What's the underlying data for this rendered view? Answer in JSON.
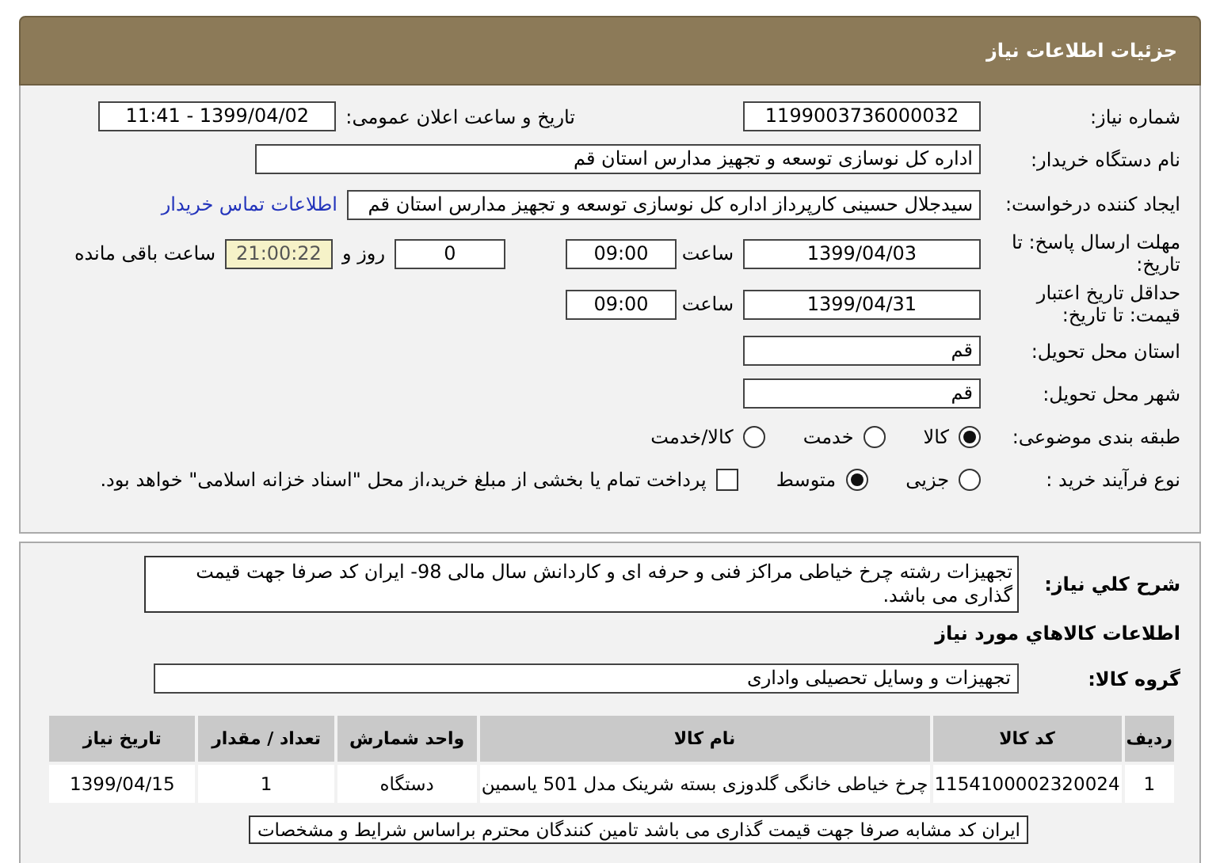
{
  "header": {
    "title": "جزئیات اطلاعات نیاز"
  },
  "need_number": {
    "label": "شماره نیاز:",
    "value": "1199003736000032"
  },
  "announce": {
    "label": "تاریخ و ساعت اعلان عمومی:",
    "value": "1399/04/02 - 11:41"
  },
  "buyer": {
    "label": "نام دستگاه خریدار:",
    "value": "اداره کل نوسازی توسعه و تجهیز مدارس استان قم"
  },
  "requester": {
    "label": "ایجاد کننده درخواست:",
    "value": "سیدجلال حسینی کارپرداز اداره کل نوسازی توسعه و تجهیز مدارس استان قم",
    "link": "اطلاعات تماس خریدار"
  },
  "deadline": {
    "label": "مهلت ارسال پاسخ: تا تاریخ:",
    "date": "1399/04/03",
    "time_label": "ساعت",
    "time": "09:00",
    "days": "0",
    "days_label": "روز و",
    "remaining": "21:00:22",
    "remaining_label": "ساعت باقی مانده"
  },
  "validity": {
    "label": "حداقل تاریخ اعتبار قیمت: تا تاریخ:",
    "date": "1399/04/31",
    "time_label": "ساعت",
    "time": "09:00"
  },
  "province": {
    "label": "استان محل تحویل:",
    "value": "قم"
  },
  "city": {
    "label": "شهر محل تحویل:",
    "value": "قم"
  },
  "category": {
    "label": "طبقه بندی موضوعی:",
    "options": [
      {
        "label": "کالا",
        "selected": true
      },
      {
        "label": "خدمت",
        "selected": false
      },
      {
        "label": "کالا/خدمت",
        "selected": false
      }
    ]
  },
  "process": {
    "label": "نوع فرآیند خرید :",
    "options": [
      {
        "label": "جزیی",
        "selected": false
      },
      {
        "label": "متوسط",
        "selected": true
      }
    ],
    "treasury": {
      "label": "پرداخت تمام یا بخشی از مبلغ خرید،از محل \"اسناد خزانه اسلامی\" خواهد بود.",
      "checked": false
    }
  },
  "description": {
    "label": "شرح کلي نياز:",
    "value": "تجهیزات رشته چرخ خیاطی مراکز فنی و حرفه ای و کاردانش سال مالی 98- ایران کد صرفا جهت قیمت گذاری می باشد."
  },
  "goods_title": "اطلاعات کالاهاي مورد نياز",
  "goods_group": {
    "label": "گروه کالا:",
    "value": "تجهیزات و وسایل تحصیلی واداری"
  },
  "table": {
    "columns": [
      "ردیف",
      "کد کالا",
      "نام کالا",
      "واحد شمارش",
      "تعداد / مقدار",
      "تاریخ نیاز"
    ],
    "rows": [
      [
        "1",
        "1154100002320024",
        "چرخ خیاطی خانگی گلدوزی بسته شرینک مدل 501 یاسمین",
        "دستگاه",
        "1",
        "1399/04/15"
      ]
    ]
  },
  "note": "ایران کد مشابه صرفا جهت قیمت گذاری می باشد تامین کنندگان محترم براساس شرایط و مشخصات"
}
